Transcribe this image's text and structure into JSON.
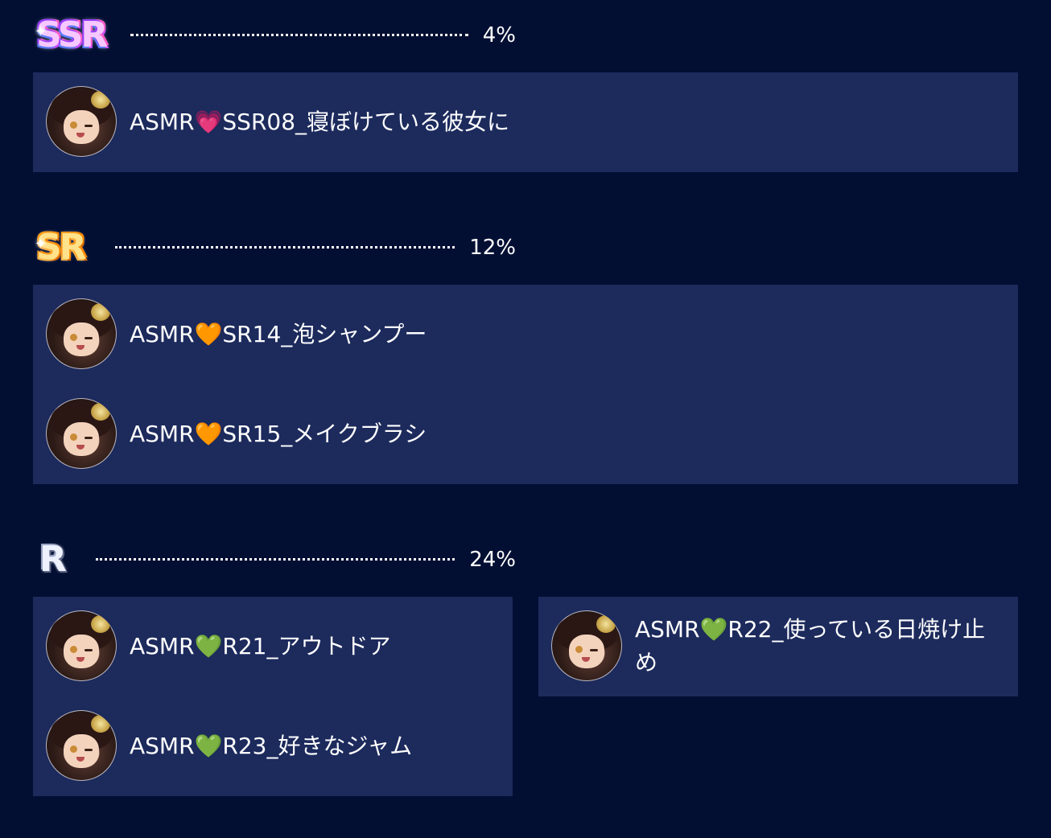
{
  "sections": [
    {
      "rarity": "SSR",
      "rate": "4%",
      "items": [
        {
          "title": "ASMR💗SSR08_寝ぼけている彼女に"
        }
      ]
    },
    {
      "rarity": "SR",
      "rate": "12%",
      "items": [
        {
          "title": "ASMR🧡SR14_泡シャンプー"
        },
        {
          "title": "ASMR🧡SR15_メイクブラシ"
        }
      ]
    },
    {
      "rarity": "R",
      "rate": "24%",
      "items": [
        {
          "title": "ASMR💚R21_アウトドア"
        },
        {
          "title": "ASMR💚R23_好きなジャム"
        },
        {
          "title": "ASMR💚R22_使っている日焼け止め"
        }
      ]
    }
  ],
  "icons": {
    "sparkle": "✦",
    "avatar": "character-avatar-icon"
  },
  "colors": {
    "background": "#020f33",
    "panel": "#1c2a5c",
    "text": "#ffffff"
  }
}
